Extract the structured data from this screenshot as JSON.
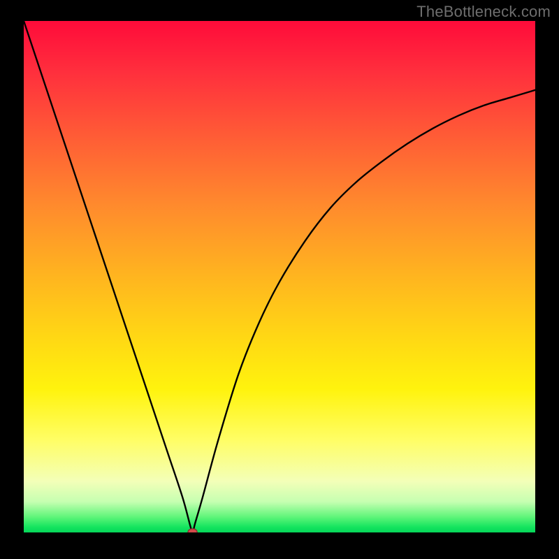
{
  "watermark": {
    "text": "TheBottleneck.com"
  },
  "colors": {
    "background": "#000000",
    "curve_stroke": "#000000",
    "marker_fill": "#d24a4a",
    "marker_stroke": "#8c2f2f",
    "gradient_stops": [
      "#ff0b3a",
      "#ff2f3d",
      "#ff5a36",
      "#ff8a2d",
      "#ffb51f",
      "#ffd814",
      "#fff30d",
      "#fffe66",
      "#f3ffb8",
      "#c6ffb1",
      "#5ef579",
      "#13e45e",
      "#06d65a"
    ]
  },
  "chart_data": {
    "type": "line",
    "title": "",
    "xlabel": "",
    "ylabel": "",
    "xlim": [
      0,
      100
    ],
    "ylim": [
      0,
      100
    ],
    "grid": false,
    "legend": false,
    "annotations": [
      {
        "kind": "marker",
        "shape": "rounded-dot",
        "x": 33,
        "y": 0,
        "color": "#d24a4a"
      }
    ],
    "series": [
      {
        "name": "curve",
        "x": [
          0,
          4,
          8,
          12,
          16,
          20,
          24,
          28,
          31,
          32.5,
          33,
          33.5,
          35,
          38,
          42,
          46,
          50,
          55,
          60,
          65,
          70,
          75,
          80,
          85,
          90,
          95,
          100
        ],
        "values": [
          100,
          88,
          76,
          64,
          52,
          40,
          28,
          16,
          7,
          1.5,
          0,
          1.8,
          7,
          18,
          31,
          41,
          49,
          57,
          63.5,
          68.5,
          72.5,
          76,
          79,
          81.5,
          83.5,
          85,
          86.5
        ]
      }
    ]
  }
}
